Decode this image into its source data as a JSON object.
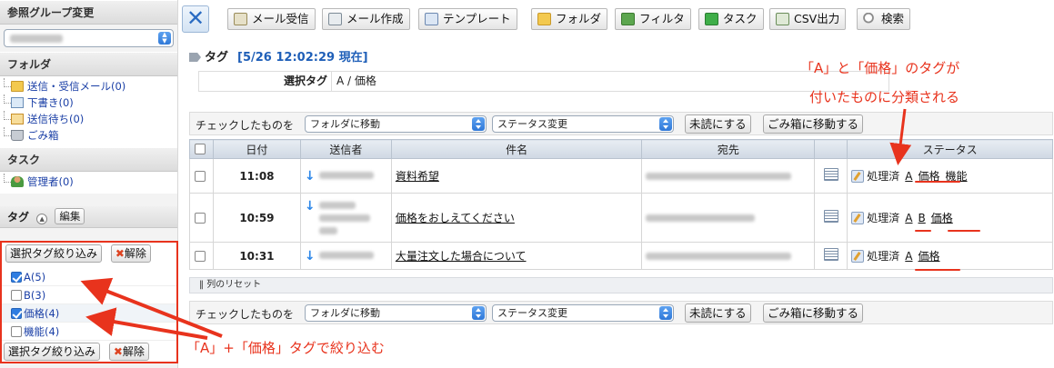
{
  "sidebar": {
    "group_header": "参照グループ変更",
    "folder_header": "フォルダ",
    "folders": [
      {
        "label": "送信・受信メール(0)"
      },
      {
        "label": "下書き(0)"
      },
      {
        "label": "送信待ち(0)"
      },
      {
        "label": "ごみ箱"
      }
    ],
    "task_header": "タスク",
    "task_items": [
      {
        "label": "管理者(0)"
      }
    ],
    "tag_header": "タグ",
    "tag_edit_label": "編集",
    "filter_button": "選択タグ絞り込み",
    "clear_button": "解除",
    "tags": [
      {
        "label": "A(5)",
        "checked": true
      },
      {
        "label": "B(3)",
        "checked": false
      },
      {
        "label": "価格(4)",
        "checked": true
      },
      {
        "label": "機能(4)",
        "checked": false
      }
    ]
  },
  "toolbar": {
    "buttons": [
      {
        "label": "メール受信",
        "icon": "mail-receive-icon"
      },
      {
        "label": "メール作成",
        "icon": "mail-compose-icon"
      },
      {
        "label": "テンプレート",
        "icon": "template-icon"
      },
      {
        "label": "フォルダ",
        "icon": "folder-icon"
      },
      {
        "label": "フィルタ",
        "icon": "filter-icon"
      },
      {
        "label": "タスク",
        "icon": "task-icon"
      },
      {
        "label": "CSV出力",
        "icon": "csv-icon"
      },
      {
        "label": "検索",
        "icon": "search-icon"
      }
    ]
  },
  "header": {
    "title": "タグ",
    "timestamp": "[5/26 12:02:29 現在]",
    "selected_tag_label": "選択タグ",
    "selected_tag_value": "A / 価格"
  },
  "actions": {
    "checked_label": "チェックしたものを",
    "folder_select": "フォルダに移動",
    "status_select": "ステータス変更",
    "mark_unread": "未読にする",
    "move_trash": "ごみ箱に移動する",
    "reset_columns": "列のリセット"
  },
  "table": {
    "columns": [
      "日付",
      "送信者",
      "件名",
      "宛先",
      "ステータス"
    ],
    "rows": [
      {
        "time": "11:08",
        "subject": "資料希望",
        "status": "処理済",
        "tags": [
          "A",
          "価格",
          "機能"
        ]
      },
      {
        "time": "10:59",
        "subject": "価格をおしえてください",
        "status": "処理済",
        "tags": [
          "A",
          "B",
          "価格"
        ]
      },
      {
        "time": "10:31",
        "subject": "大量注文した場合について",
        "status": "処理済",
        "tags": [
          "A",
          "価格"
        ]
      }
    ]
  },
  "annotations": {
    "top_line1": "「A」と「価格」のタグが",
    "top_line2": "付いたものに分類される",
    "bottom": "「A」+「価格」タグで絞り込む"
  },
  "colors": {
    "annotation": "#e8331d",
    "accent": "#1f5fb8"
  }
}
